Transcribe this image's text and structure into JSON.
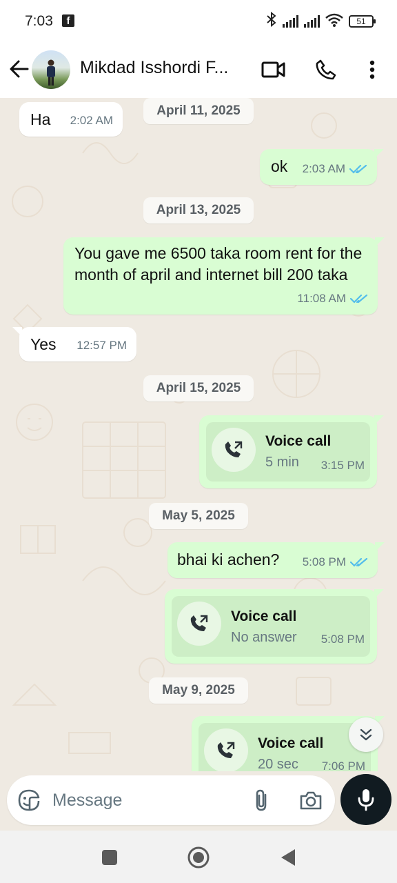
{
  "status_bar": {
    "time": "7:03",
    "battery": "51"
  },
  "header": {
    "contact_name": "Mikdad Isshordi F..."
  },
  "messages": [
    {
      "type": "text",
      "dir": "in",
      "text": "Ha",
      "time": "2:02 AM"
    },
    {
      "type": "date",
      "text": "April 11, 2025"
    },
    {
      "type": "text",
      "dir": "out",
      "text": "ok",
      "time": "2:03 AM",
      "ticks": "read"
    },
    {
      "type": "date",
      "text": "April 13, 2025"
    },
    {
      "type": "text",
      "dir": "out",
      "text": "You gave me 6500 taka room rent for the month of april and internet bill 200 taka",
      "time": "11:08 AM",
      "ticks": "read"
    },
    {
      "type": "text",
      "dir": "in",
      "text": "Yes",
      "time": "12:57 PM"
    },
    {
      "type": "date",
      "text": "April 15, 2025"
    },
    {
      "type": "call",
      "dir": "out",
      "title": "Voice call",
      "sub": "5 min",
      "time": "3:15 PM"
    },
    {
      "type": "date",
      "text": "May 5, 2025"
    },
    {
      "type": "text",
      "dir": "out",
      "text": "bhai ki achen?",
      "time": "5:08 PM",
      "ticks": "read"
    },
    {
      "type": "call",
      "dir": "out",
      "title": "Voice call",
      "sub": "No answer",
      "time": "5:08 PM"
    },
    {
      "type": "date",
      "text": "May 9, 2025"
    },
    {
      "type": "call",
      "dir": "out",
      "title": "Voice call",
      "sub": "20 sec",
      "time": "7:06 PM"
    }
  ],
  "input": {
    "placeholder": "Message"
  },
  "colors": {
    "outgoing": "#d9fdd3",
    "incoming": "#ffffff",
    "read_ticks": "#53bdeb",
    "background": "#efeae2"
  },
  "icons": [
    "back-arrow-icon",
    "video-call-icon",
    "phone-icon",
    "more-vert-icon",
    "sticker-icon",
    "attach-icon",
    "camera-icon",
    "mic-icon",
    "outgoing-call-icon",
    "double-chevron-down-icon"
  ]
}
